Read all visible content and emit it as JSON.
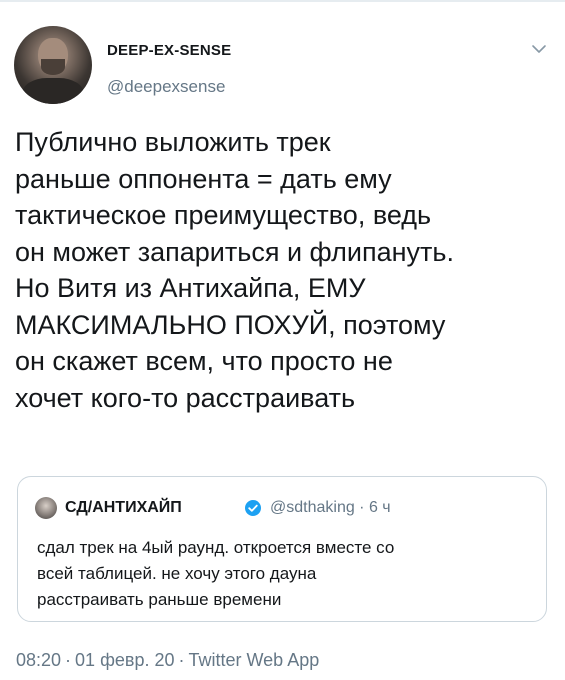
{
  "author": {
    "display_name": "DEEP-EX-SENSE",
    "handle": "@deepexsense",
    "avatar_icon": "person-avatar"
  },
  "menu": {
    "caret_icon": "chevron-down-icon"
  },
  "tweet": {
    "text": "Публично выложить трек\nраньше оппонента = дать ему\nтактическое преимущество, ведь\nон может запариться и флипануть.\nНо Витя из Антихайпа, ЕМУ\nМАКСИМАЛЬНО ПОХУЙ, поэтому\nон скажет всем, что просто не\nхочет кого-то расстраивать"
  },
  "quoted_tweet": {
    "display_name": "СД/АНТИХАЙП",
    "verified_icon": "verified-badge-icon",
    "handle_time": "@sdthaking · 6 ч",
    "text": "сдал трек на 4ый раунд. откроется вместе со\nвсей таблицей. не хочу этого дауна\nрасстраивать раньше времени"
  },
  "footer": {
    "time": "08:20",
    "date": "01 февр. 20",
    "separator": "·",
    "source": "Twitter Web App"
  },
  "colors": {
    "text": "#14171a",
    "secondary": "#657786",
    "border": "#ccd6dd",
    "verified": "#1da1f2"
  }
}
